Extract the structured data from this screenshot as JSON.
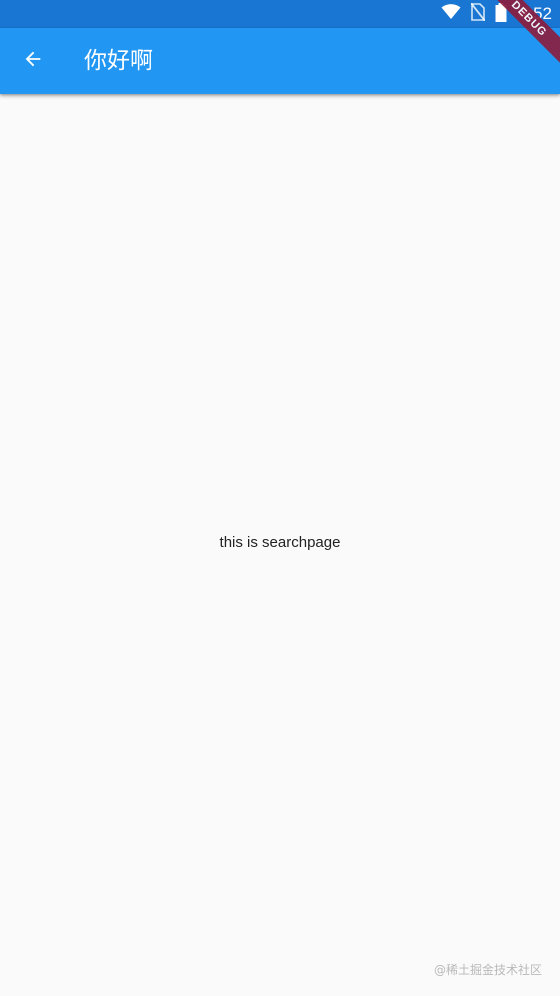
{
  "status_bar": {
    "time": "4:52",
    "icons": [
      "wifi-icon",
      "no-sim-icon",
      "battery-icon"
    ],
    "background": "#1976d2"
  },
  "app_bar": {
    "back_icon": "arrow-back-icon",
    "title": "你好啊",
    "background": "#2196f3"
  },
  "debug_banner": {
    "label": "DEBUG",
    "color": "#8b1e3f"
  },
  "body": {
    "text": "this is searchpage",
    "background": "#fafafa"
  },
  "watermark": {
    "text": "@稀土掘金技术社区"
  }
}
